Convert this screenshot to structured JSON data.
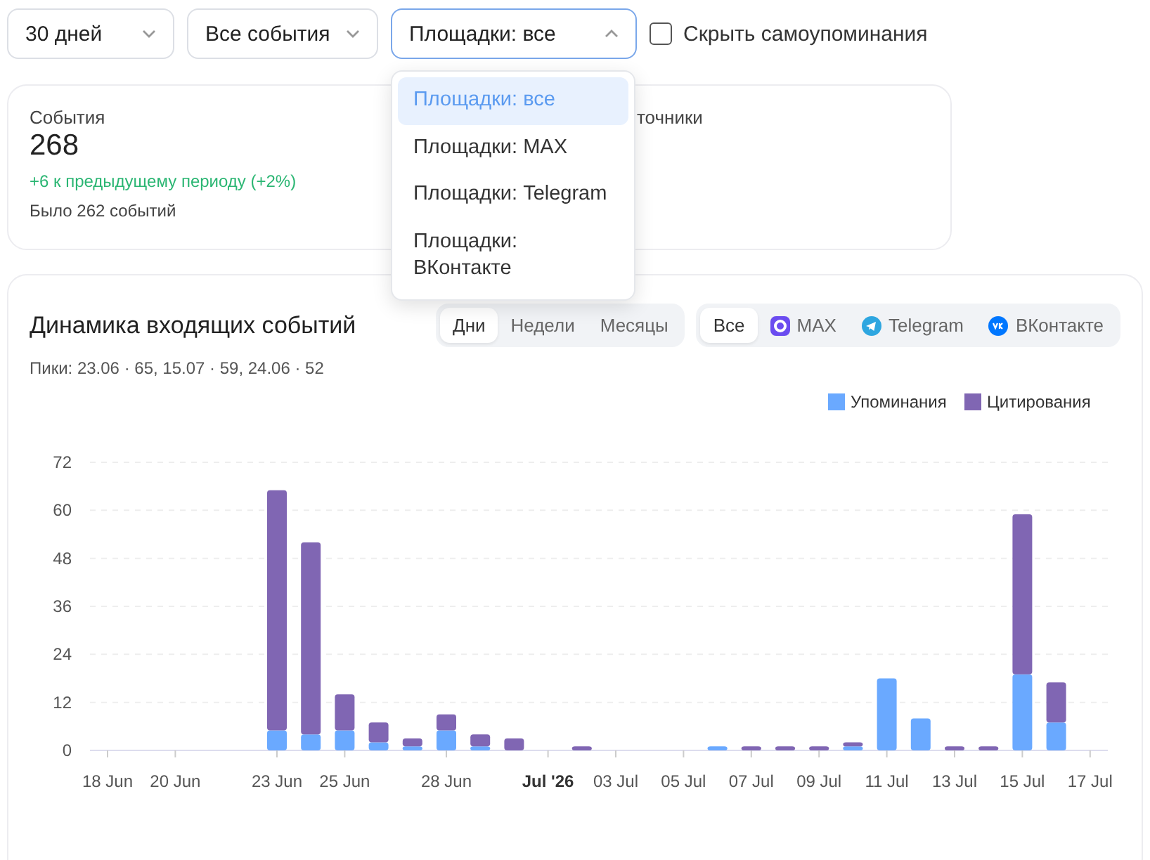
{
  "filters": {
    "period": "30 дней",
    "events": "Все события",
    "platform": {
      "value": "Площадки: все",
      "open": true,
      "options": [
        {
          "label": "Площадки: все",
          "selected": true
        },
        {
          "label": "Площадки: MAX",
          "selected": false
        },
        {
          "label": "Площадки: Telegram",
          "selected": false
        },
        {
          "label": "Площадки: ВКонтакте",
          "selected": false
        }
      ]
    },
    "hide_self": {
      "label": "Скрыть самоупоминания",
      "checked": false
    }
  },
  "cards": [
    {
      "title": "События",
      "value": "268",
      "delta": "+6 к предыдущему периоду (+2%)",
      "previous": "Было 262 событий"
    },
    {
      "title": "точники"
    }
  ],
  "panel": {
    "title": "Динамика входящих событий",
    "peaks": "Пики: 23.06 · 65, 15.07 · 59, 24.06 · 52",
    "granularity": [
      {
        "label": "Дни",
        "selected": true
      },
      {
        "label": "Недели",
        "selected": false
      },
      {
        "label": "Месяцы",
        "selected": false
      }
    ],
    "sources": [
      {
        "label": "Все",
        "kind": "all",
        "selected": true
      },
      {
        "label": "MAX",
        "kind": "max",
        "selected": false
      },
      {
        "label": "Telegram",
        "kind": "telegram",
        "selected": false
      },
      {
        "label": "ВКонтакте",
        "kind": "vk",
        "selected": false
      }
    ],
    "chart_data": {
      "type": "bar",
      "stacked": true,
      "grid": true,
      "legend": true,
      "categories": [
        "18 Jun",
        null,
        "20 Jun",
        null,
        null,
        "23 Jun",
        null,
        "25 Jun",
        null,
        null,
        "28 Jun",
        null,
        null,
        "Jul '26",
        null,
        "03 Jul",
        null,
        "05 Jul",
        null,
        "07 Jul",
        null,
        "09 Jul",
        null,
        "11 Jul",
        null,
        "13 Jul",
        null,
        "15 Jul",
        null,
        "17 Jul"
      ],
      "series": [
        {
          "name": "Упоминания",
          "color": "#6aa9ff",
          "values": [
            0,
            0,
            0,
            0,
            0,
            5,
            4,
            5,
            2,
            1,
            5,
            1,
            0,
            0,
            0,
            0,
            0,
            0,
            1,
            0,
            0,
            0,
            1,
            18,
            8,
            0,
            0,
            19,
            7,
            0
          ]
        },
        {
          "name": "Цитирования",
          "color": "#8066b3",
          "values": [
            0,
            0,
            0,
            0,
            0,
            60,
            48,
            9,
            5,
            2,
            4,
            3,
            3,
            0,
            1,
            0,
            0,
            0,
            0,
            1,
            1,
            1,
            1,
            0,
            0,
            1,
            1,
            40,
            10,
            0
          ]
        }
      ],
      "ylim": [
        0,
        72
      ],
      "yticks": [
        0,
        12,
        24,
        36,
        48,
        60,
        72
      ]
    }
  }
}
